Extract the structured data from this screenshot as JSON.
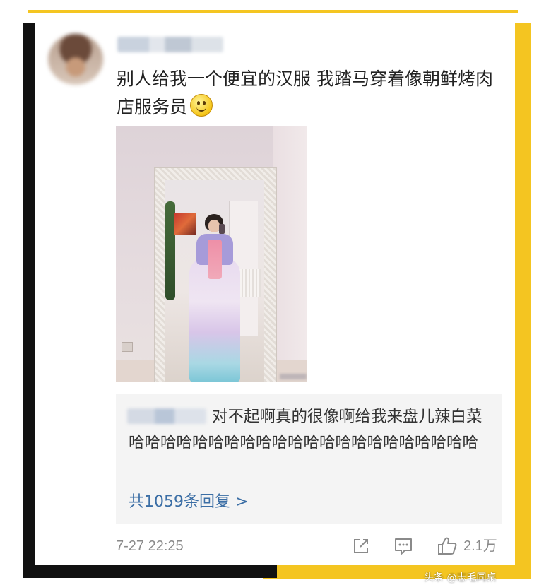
{
  "post": {
    "text": "别人给我一个便宜的汉服 我踏马穿着像朝鲜烤肉店服务员"
  },
  "reply": {
    "text": "对不起啊真的很像啊给我来盘儿辣白菜哈哈哈哈哈哈哈哈哈哈哈哈哈哈哈哈哈哈哈哈哈哈",
    "more_link": "共1059条回复 >"
  },
  "footer": {
    "timestamp": "7-27 22:25",
    "like_count": "2.1万"
  },
  "credit": "头条 @志毛同桌",
  "colors": {
    "accent_yellow": "#f4c521",
    "frame_black": "#111111",
    "link_blue": "#3b6ea5",
    "meta_gray": "#8a8a8a"
  },
  "icons": [
    "share-icon",
    "comment-icon",
    "like-icon",
    "smiley-emoji-icon"
  ]
}
